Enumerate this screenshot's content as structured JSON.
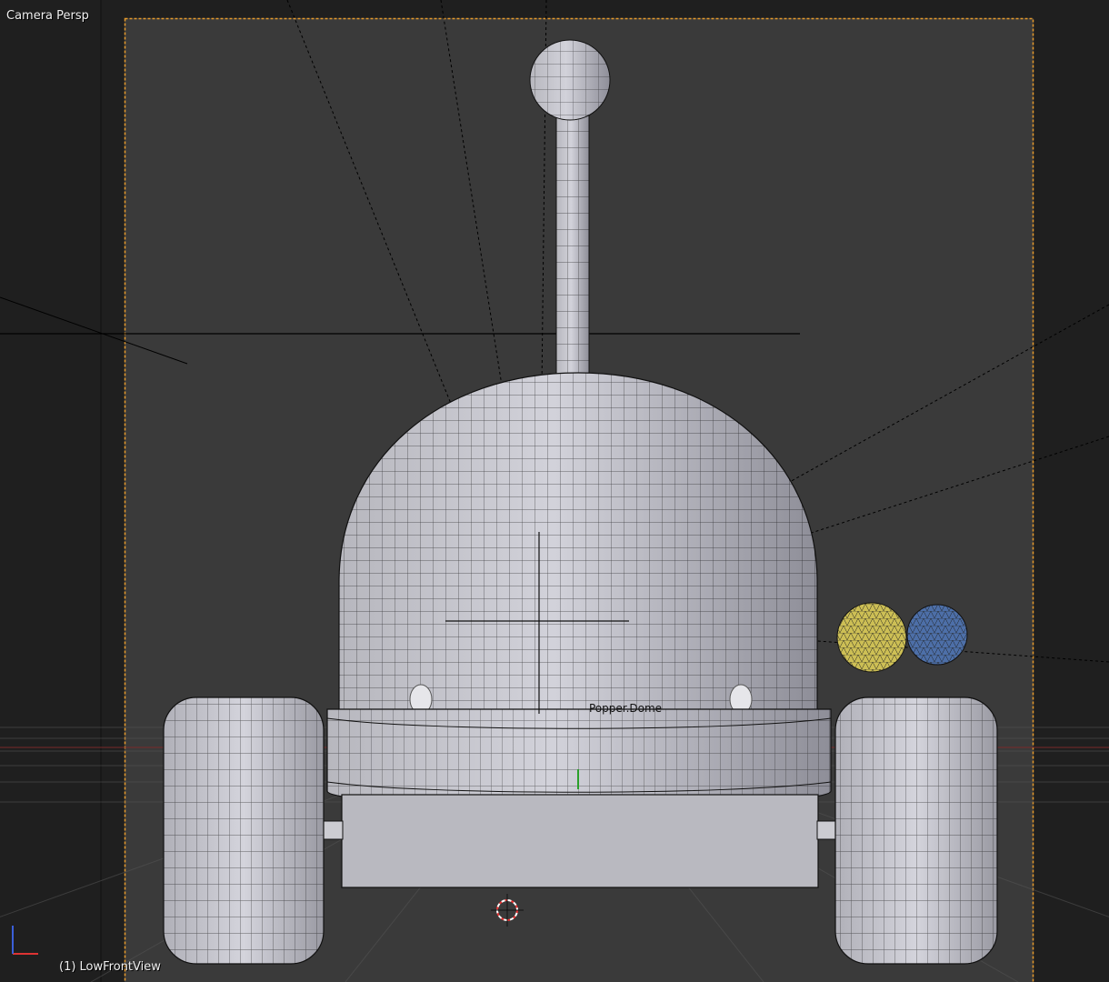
{
  "viewport": {
    "view_name": "Camera Persp",
    "frame_info": "(1) LowFrontView",
    "active_object_label": "Popper.Dome"
  },
  "colors": {
    "background_outside": "#1f1f1f",
    "camera_area": "#3a3a3a",
    "camera_frame": "#e69a2c",
    "mesh_fill": "#c4c4cc",
    "wire": "#111111",
    "light_yellow": "#cdbf55",
    "light_blue": "#4d6fa8"
  },
  "icons": [
    "axis-gizmo-icon",
    "3d-cursor-icon",
    "light-yellow-sphere",
    "light-blue-sphere"
  ]
}
